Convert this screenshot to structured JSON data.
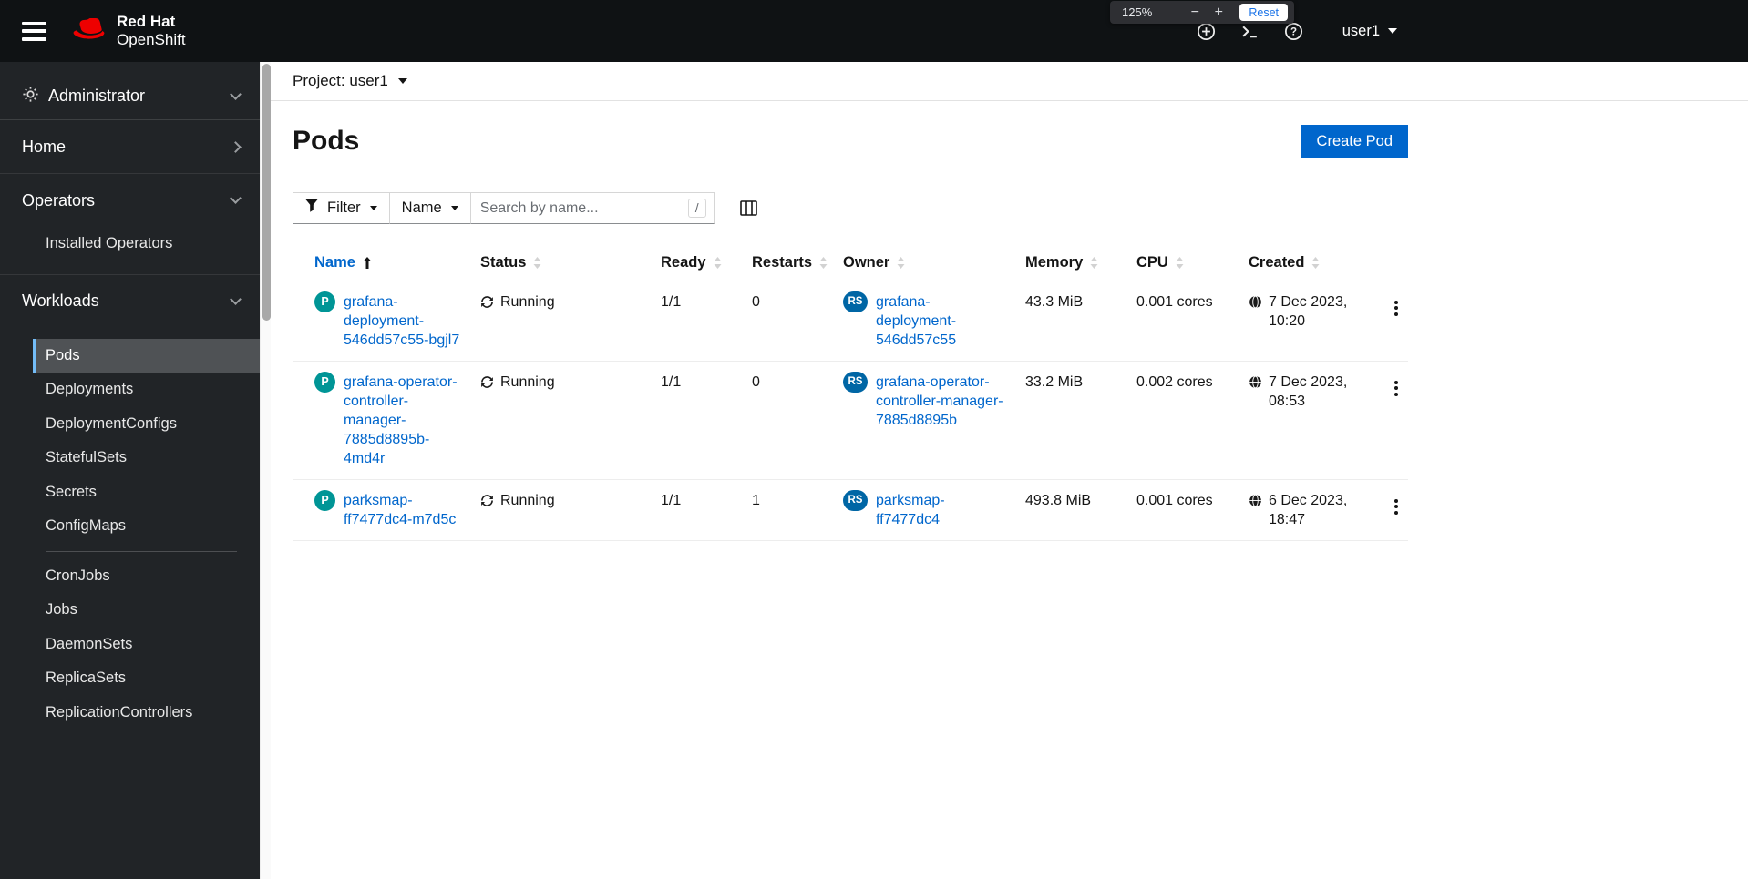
{
  "masthead": {
    "brand_top": "Red Hat",
    "brand_bottom": "OpenShift",
    "user": "user1",
    "icon_names": [
      "plus-circle",
      "terminal",
      "question-circle"
    ]
  },
  "zoom": {
    "level": "125%",
    "minus": "−",
    "plus": "+",
    "reset": "Reset"
  },
  "sidebar": {
    "perspective": "Administrator",
    "home": "Home",
    "operators": "Operators",
    "installed_operators": "Installed Operators",
    "workloads": "Workloads",
    "workload_items_a": [
      "Pods",
      "Deployments",
      "DeploymentConfigs",
      "StatefulSets",
      "Secrets",
      "ConfigMaps"
    ],
    "workload_items_b": [
      "CronJobs",
      "Jobs",
      "DaemonSets",
      "ReplicaSets",
      "ReplicationControllers"
    ],
    "selected_item": "Pods"
  },
  "project": {
    "label": "Project: user1"
  },
  "page": {
    "title": "Pods",
    "create_button": "Create Pod"
  },
  "toolbar": {
    "filter": "Filter",
    "name_filter": "Name",
    "search_placeholder": "Search by name...",
    "shortcut_key": "/"
  },
  "table": {
    "columns": [
      "Name",
      "Status",
      "Ready",
      "Restarts",
      "Owner",
      "Memory",
      "CPU",
      "Created"
    ],
    "sorted_by": "Name",
    "sort_direction": "ascending",
    "rows": [
      {
        "name": "grafana-deployment-546dd57c55-bgjl7",
        "status": "Running",
        "ready": "1/1",
        "restarts": "0",
        "owner": "grafana-deployment-546dd57c55",
        "memory": "43.3 MiB",
        "cpu": "0.001 cores",
        "created": "7 Dec 2023, 10:20"
      },
      {
        "name": "grafana-operator-controller-manager-7885d8895b-4md4r",
        "status": "Running",
        "ready": "1/1",
        "restarts": "0",
        "owner": "grafana-operator-controller-manager-7885d8895b",
        "memory": "33.2 MiB",
        "cpu": "0.002 cores",
        "created": "7 Dec 2023, 08:53"
      },
      {
        "name": "parksmap-ff7477dc4-m7d5c",
        "status": "Running",
        "ready": "1/1",
        "restarts": "1",
        "owner": "parksmap-ff7477dc4",
        "memory": "493.8 MiB",
        "cpu": "0.001 cores",
        "created": "6 Dec 2023, 18:47"
      }
    ]
  },
  "badges": {
    "pod_abbr": "P",
    "replicaset_abbr": "RS"
  },
  "colors": {
    "accent": "#0066cc",
    "pod_badge": "#009596",
    "replicaset_badge": "#0066a5",
    "nav_selected_indicator": "#73bcf7",
    "brand_red": "#ee0000",
    "masthead_bg": "#0f1214",
    "sidebar_bg": "#212427"
  }
}
